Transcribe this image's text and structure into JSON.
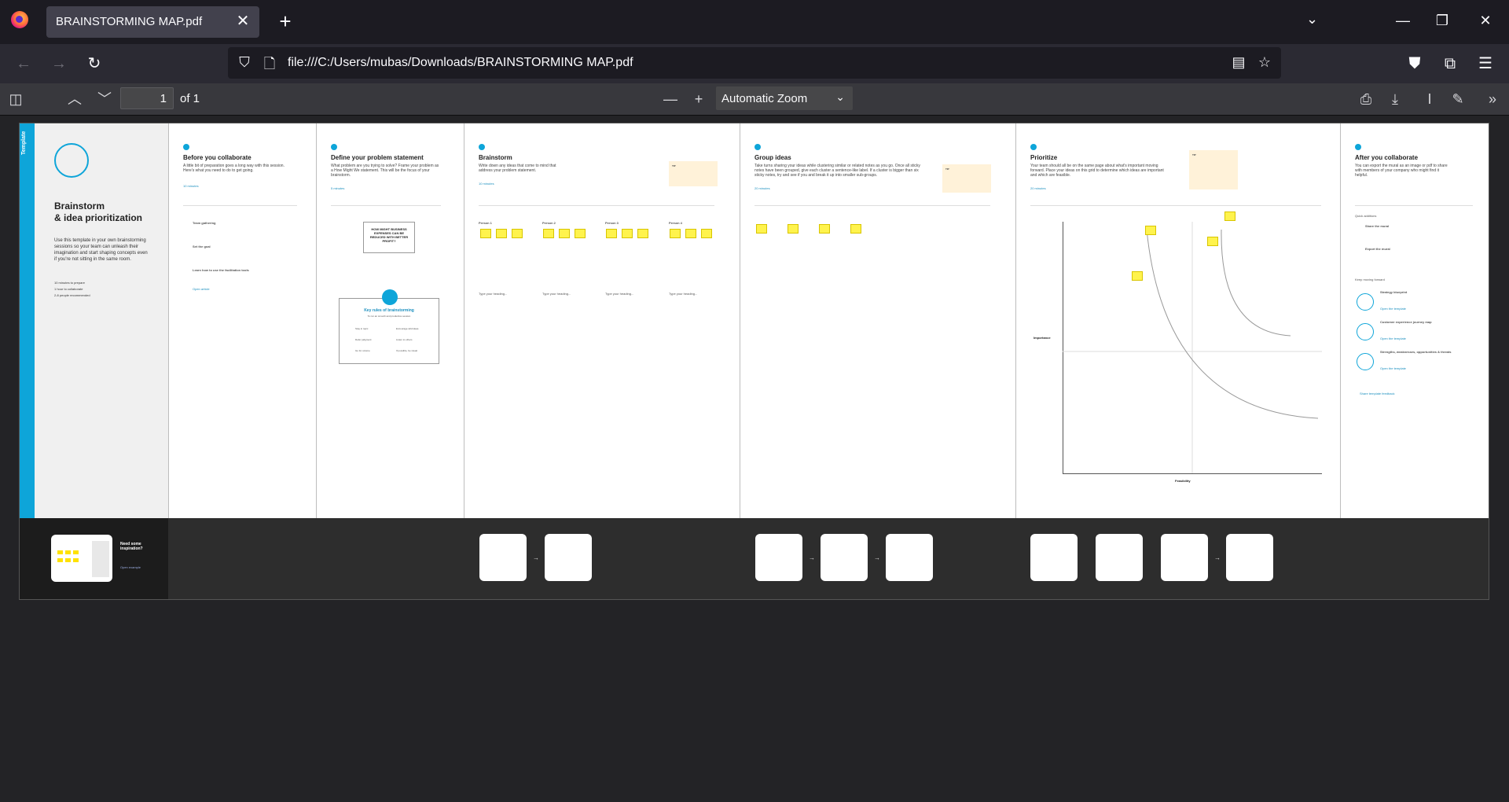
{
  "browser": {
    "tab_title": "BRAINSTORMING MAP.pdf",
    "url": "file:///C:/Users/mubas/Downloads/BRAINSTORMING MAP.pdf"
  },
  "pdf_toolbar": {
    "page_number": "1",
    "page_count_label": "of 1",
    "zoom": "Automatic Zoom"
  },
  "document": {
    "strip_label": "Template",
    "intro": {
      "title_line1": "Brainstorm",
      "title_line2": "& idea prioritization",
      "description": "Use this template in your own brainstorming sessions so your team can unleash their imagination and start shaping concepts even if you're not sitting in the same room.",
      "meta": [
        "10 minutes to prepare",
        "1 hour to collaborate",
        "2-8 people recommended"
      ]
    },
    "sections": [
      {
        "title": "Before you collaborate",
        "desc": "A little bit of preparation goes a long way with this session. Here's what you need to do to get going.",
        "time": "10 minutes"
      },
      {
        "title": "Define your problem statement",
        "desc": "What problem are you trying to solve? Frame your problem as a How Might We statement. This will be the focus of your brainstorm.",
        "time": "5 minutes"
      },
      {
        "title": "Brainstorm",
        "desc": "Write down any ideas that come to mind that address your problem statement.",
        "time": "10 minutes"
      },
      {
        "title": "Group ideas",
        "desc": "Take turns sharing your ideas while clustering similar or related notes as you go. Once all sticky notes have been grouped, give each cluster a sentence-like label. If a cluster is bigger than six sticky notes, try and see if you and break it up into smaller sub-groups.",
        "time": "20 minutes"
      },
      {
        "title": "Prioritize",
        "desc": "Your team should all be on the same page about what's important moving forward. Place your ideas on this grid to determine which ideas are important and which are feasible.",
        "time": "20 minutes"
      },
      {
        "title": "After you collaborate",
        "desc": "You can export the mural as an image or pdf to share with members of your company who might find it helpful."
      }
    ],
    "steps": [
      "Team gathering",
      "Set the goal",
      "Learn how to use the facilitation tools"
    ],
    "open_article": "Open article",
    "problem_statement": "HOW MIGHT BUSINESS EXPENSES CAN BE REDUCED WITH BETTER PROFIT?",
    "rules_title": "Key rules of brainstorming",
    "rules_subtitle": "To run an smooth and productive session",
    "rules": [
      "Stay in topic",
      "Encourage wild ideas",
      "Defer judgment",
      "Listen to others",
      "Go for volume",
      "If possible, be visual"
    ],
    "persons": [
      "Person 1",
      "Person 2",
      "Person 3",
      "Person 4"
    ],
    "type_heading": "Type your heading...",
    "tip_label": "TIP",
    "graph": {
      "y_label": "Importance",
      "x_label": "Feasibility"
    },
    "after": {
      "quick_add": "Quick additions",
      "share": "Share the mural",
      "export": "Export the mural",
      "keep": "Keep moving forward",
      "items": [
        "Strategy blueprint",
        "Customer experience journey map",
        "Strengths, weaknesses, opportunities & threats"
      ],
      "open_template": "Open the template",
      "feedback": "Share template feedback"
    },
    "inspiration": "Need some inspiration?",
    "open_example": "Open example"
  }
}
